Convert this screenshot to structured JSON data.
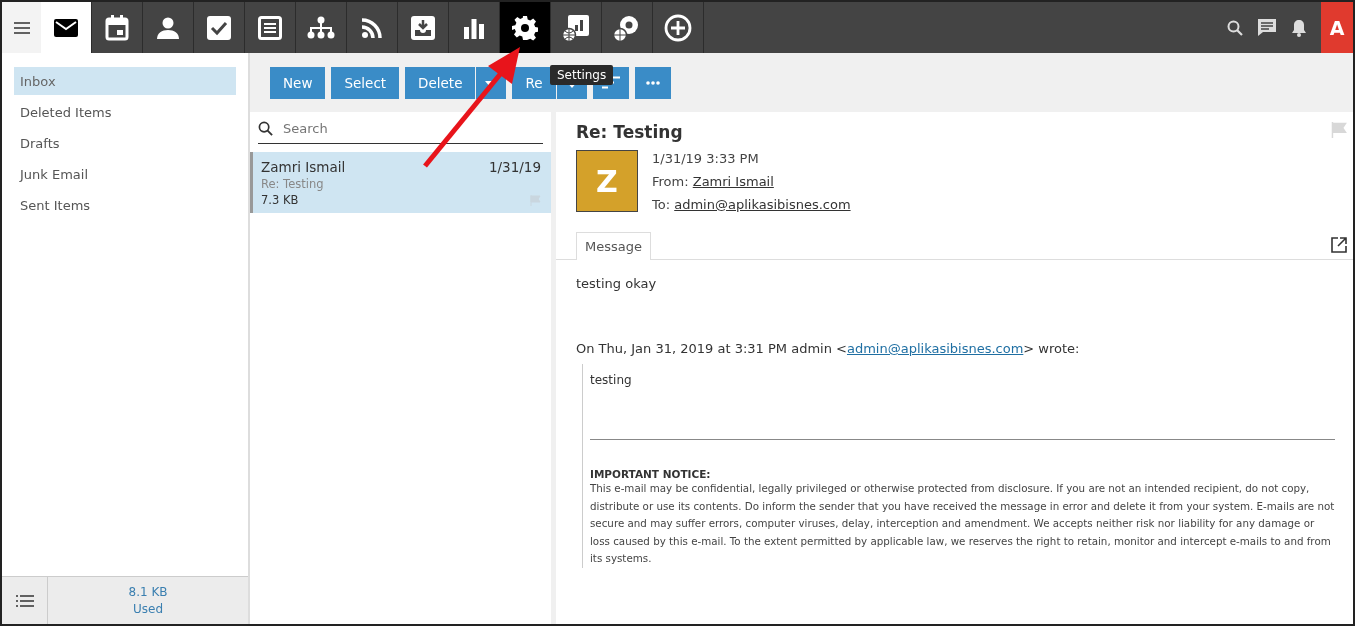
{
  "nav": {
    "tiles": [
      {
        "kind": "mail",
        "selected": true,
        "hover": false
      },
      {
        "kind": "calendar",
        "selected": false,
        "hover": false
      },
      {
        "kind": "contacts",
        "selected": false,
        "hover": false
      },
      {
        "kind": "tasks",
        "selected": false,
        "hover": false
      },
      {
        "kind": "notes",
        "selected": false,
        "hover": false
      },
      {
        "kind": "org",
        "selected": false,
        "hover": false
      },
      {
        "kind": "rss",
        "selected": false,
        "hover": false
      },
      {
        "kind": "download",
        "selected": false,
        "hover": false
      },
      {
        "kind": "chart",
        "selected": false,
        "hover": false
      },
      {
        "kind": "settings",
        "selected": false,
        "hover": true
      },
      {
        "kind": "globe-report",
        "selected": false,
        "hover": false
      },
      {
        "kind": "globe-gear",
        "selected": false,
        "hover": false
      },
      {
        "kind": "add",
        "selected": false,
        "hover": false
      }
    ],
    "avatar": "A"
  },
  "folders": [
    {
      "label": "Inbox",
      "selected": true
    },
    {
      "label": "Deleted Items",
      "selected": false
    },
    {
      "label": "Drafts",
      "selected": false
    },
    {
      "label": "Junk Email",
      "selected": false
    },
    {
      "label": "Sent Items",
      "selected": false
    }
  ],
  "storage": {
    "size": "8.1 KB",
    "label": "Used"
  },
  "toolbar": {
    "buttons": [
      {
        "kind": "text",
        "label": "New"
      },
      {
        "kind": "text",
        "label": "Select"
      },
      {
        "kind": "split",
        "label": "Delete"
      },
      {
        "kind": "split",
        "label": "Re"
      },
      {
        "kind": "sort"
      },
      {
        "kind": "more"
      }
    ],
    "tooltip": "Settings"
  },
  "search": {
    "placeholder": "Search"
  },
  "messages": [
    {
      "sender": "Zamri Ismail",
      "date": "1/31/19",
      "subject": "Re: Testing",
      "size": "7.3 KB",
      "selected": true,
      "flagged": false
    }
  ],
  "reading": {
    "subject": "Re: Testing",
    "flagged": false,
    "initial": "Z",
    "color": "#d4a12a",
    "date": "1/31/19 3:33 PM",
    "from_label": "From:",
    "from": "Zamri Ismail",
    "to_label": "To:",
    "to": "admin@aplikasibisnes.com",
    "tabs": [
      {
        "label": "Message",
        "selected": true
      }
    ],
    "body": "testing okay",
    "quote_intro": "On Thu, Jan 31, 2019 at 3:31 PM admin <",
    "quote_link": "admin@aplikasibisnes.com",
    "quote_outro": "> wrote:",
    "quote_text": "testing",
    "notice_title": "IMPORTANT NOTICE:",
    "notice": "This e-mail may be confidential, legally privileged or otherwise protected from disclosure. If you are not an intended recipient, do not copy, distribute or use its contents. Do inform the sender that you have received the message in error and delete it from your system. E-mails are not secure and may suffer errors, computer viruses, delay, interception and amendment. We accepts neither risk nor liability for any damage or loss caused by this e-mail. To the extent permitted by applicable law, we reserves the right to retain, monitor and intercept e-mails to and from its systems."
  }
}
